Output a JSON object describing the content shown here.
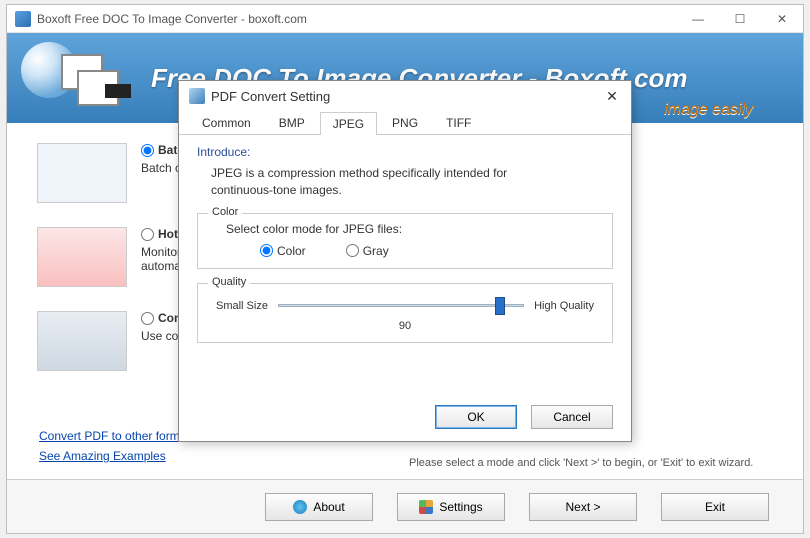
{
  "window": {
    "title": "Boxoft Free DOC To Image Converter - boxoft.com",
    "banner_title": "Free DOC To Image Converter - Boxoft.com",
    "banner_sub": "image easily"
  },
  "options": {
    "batch": {
      "label": "Batch Convert Mode",
      "desc": "Batch convert DOC document to image files."
    },
    "hot": {
      "label": "Hot Directories Mode",
      "desc": "Monitor a directory and convert incoming files automatically."
    },
    "cmd": {
      "label": "Command Line Mode",
      "desc": "Use command-line style to convert DOC to images."
    }
  },
  "links": {
    "l1": "Convert PDF to other formats",
    "l2": "See Amazing Examples"
  },
  "hint": "Please select a mode and click 'Next >' to begin, or 'Exit' to exit wizard.",
  "toolbar": {
    "about": "About",
    "settings": "Settings",
    "next": "Next >",
    "exit": "Exit"
  },
  "dialog": {
    "title": "PDF Convert Setting",
    "tabs": [
      "Common",
      "BMP",
      "JPEG",
      "PNG",
      "TIFF"
    ],
    "active_tab": "JPEG",
    "intro_label": "Introduce:",
    "intro_text": "JPEG is a compression method specifically intended for continuous-tone images.",
    "color": {
      "legend": "Color",
      "label": "Select color mode for JPEG files:",
      "opt_color": "Color",
      "opt_gray": "Gray",
      "selected": "Color"
    },
    "quality": {
      "legend": "Quality",
      "left": "Small Size",
      "right": "High Quality",
      "value": "90"
    },
    "ok": "OK",
    "cancel": "Cancel"
  }
}
